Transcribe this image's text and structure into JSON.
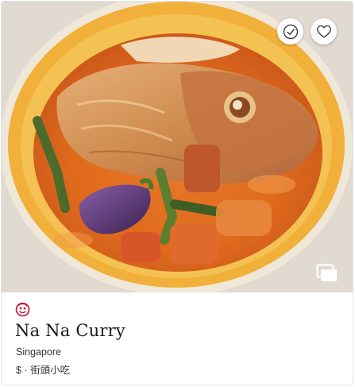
{
  "restaurant": {
    "name": "Na Na Curry",
    "location": "Singapore",
    "price": "$",
    "separator": "·",
    "cuisine": "街頭小吃"
  },
  "colors": {
    "accent": "#c8102e",
    "text": "#1a1a1a",
    "subtext": "#333333"
  },
  "icons": {
    "visited": "check-circle-icon",
    "save": "heart-icon",
    "gallery": "gallery-icon",
    "logo": "michelin-guide-logo"
  }
}
